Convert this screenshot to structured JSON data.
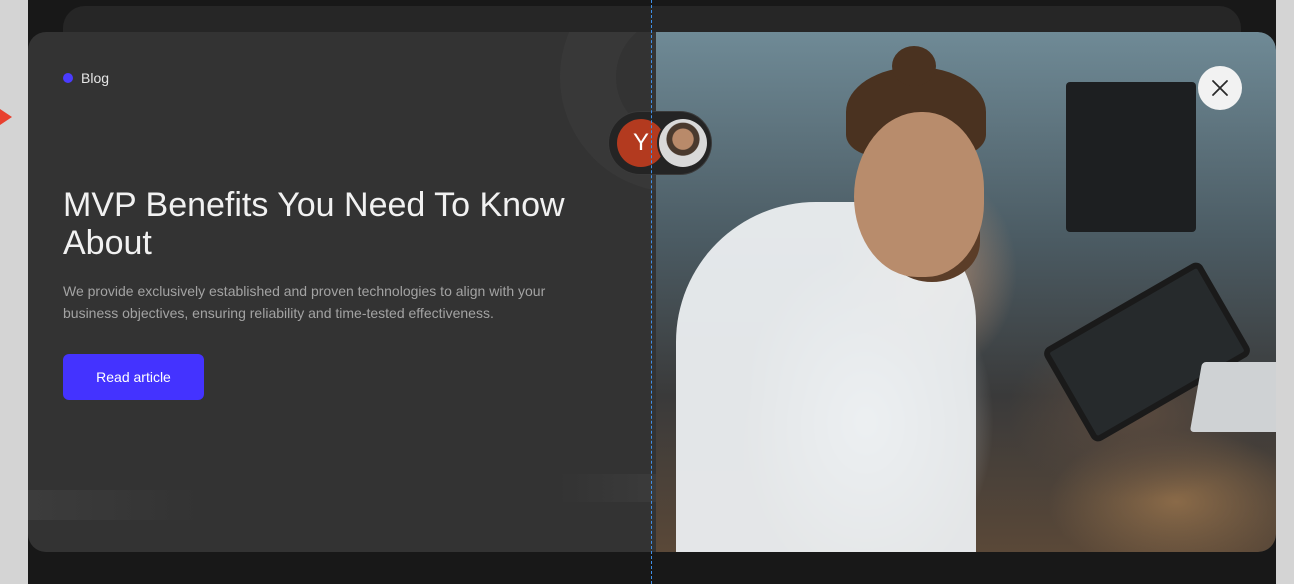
{
  "page": {
    "tag_label": "Blog",
    "title": "MVP Benefits You Need To Know About",
    "description": "We provide exclusively established and proven technologies to align with your business objectives, ensuring reliability and time-tested effectiveness.",
    "cta_label": "Read article"
  },
  "avatars": {
    "initial": "Y"
  },
  "icons": {
    "close": "close-icon",
    "tag_dot": "dot-icon"
  },
  "colors": {
    "accent": "#4433ff",
    "card_bg": "#333333",
    "avatar_initial_bg": "#b33a1f",
    "guide_line": "#3f8fe6"
  }
}
